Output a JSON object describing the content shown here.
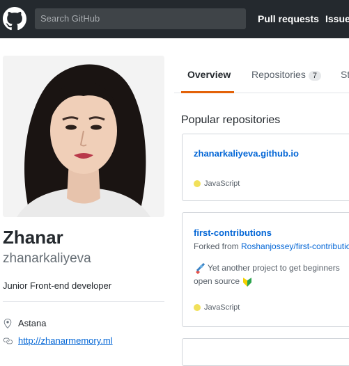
{
  "header": {
    "search_placeholder": "Search GitHub",
    "nav": {
      "pull_requests": "Pull requests",
      "issues": "Issues"
    }
  },
  "profile": {
    "full_name": "Zhanar",
    "username": "zhanarkaliyeva",
    "bio": "Junior Front-end developer",
    "location": "Astana",
    "website": "http://zhanarmemory.ml"
  },
  "tabs": {
    "overview": "Overview",
    "repositories": "Repositories",
    "repositories_count": "7",
    "stars": "St"
  },
  "popular": {
    "title": "Popular repositories",
    "repos": [
      {
        "name": "zhanarkaliyeva.github.io",
        "language": "JavaScript",
        "lang_color": "#f1e05a"
      },
      {
        "name": "first-contributions",
        "forked_prefix": "Forked from ",
        "forked_from": "Roshanjossey/first-contributions",
        "description_line1": "Yet another project to get beginners",
        "description_line2": "open source",
        "language": "JavaScript",
        "lang_color": "#f1e05a"
      }
    ]
  },
  "colors": {
    "header_bg": "#24292e",
    "link": "#0366d6",
    "active_tab": "#e36209",
    "javascript": "#f1e05a"
  },
  "icons": [
    "github-logo-icon",
    "location-icon",
    "link-icon",
    "rocket-icon",
    "beginner-leaf-icon"
  ]
}
